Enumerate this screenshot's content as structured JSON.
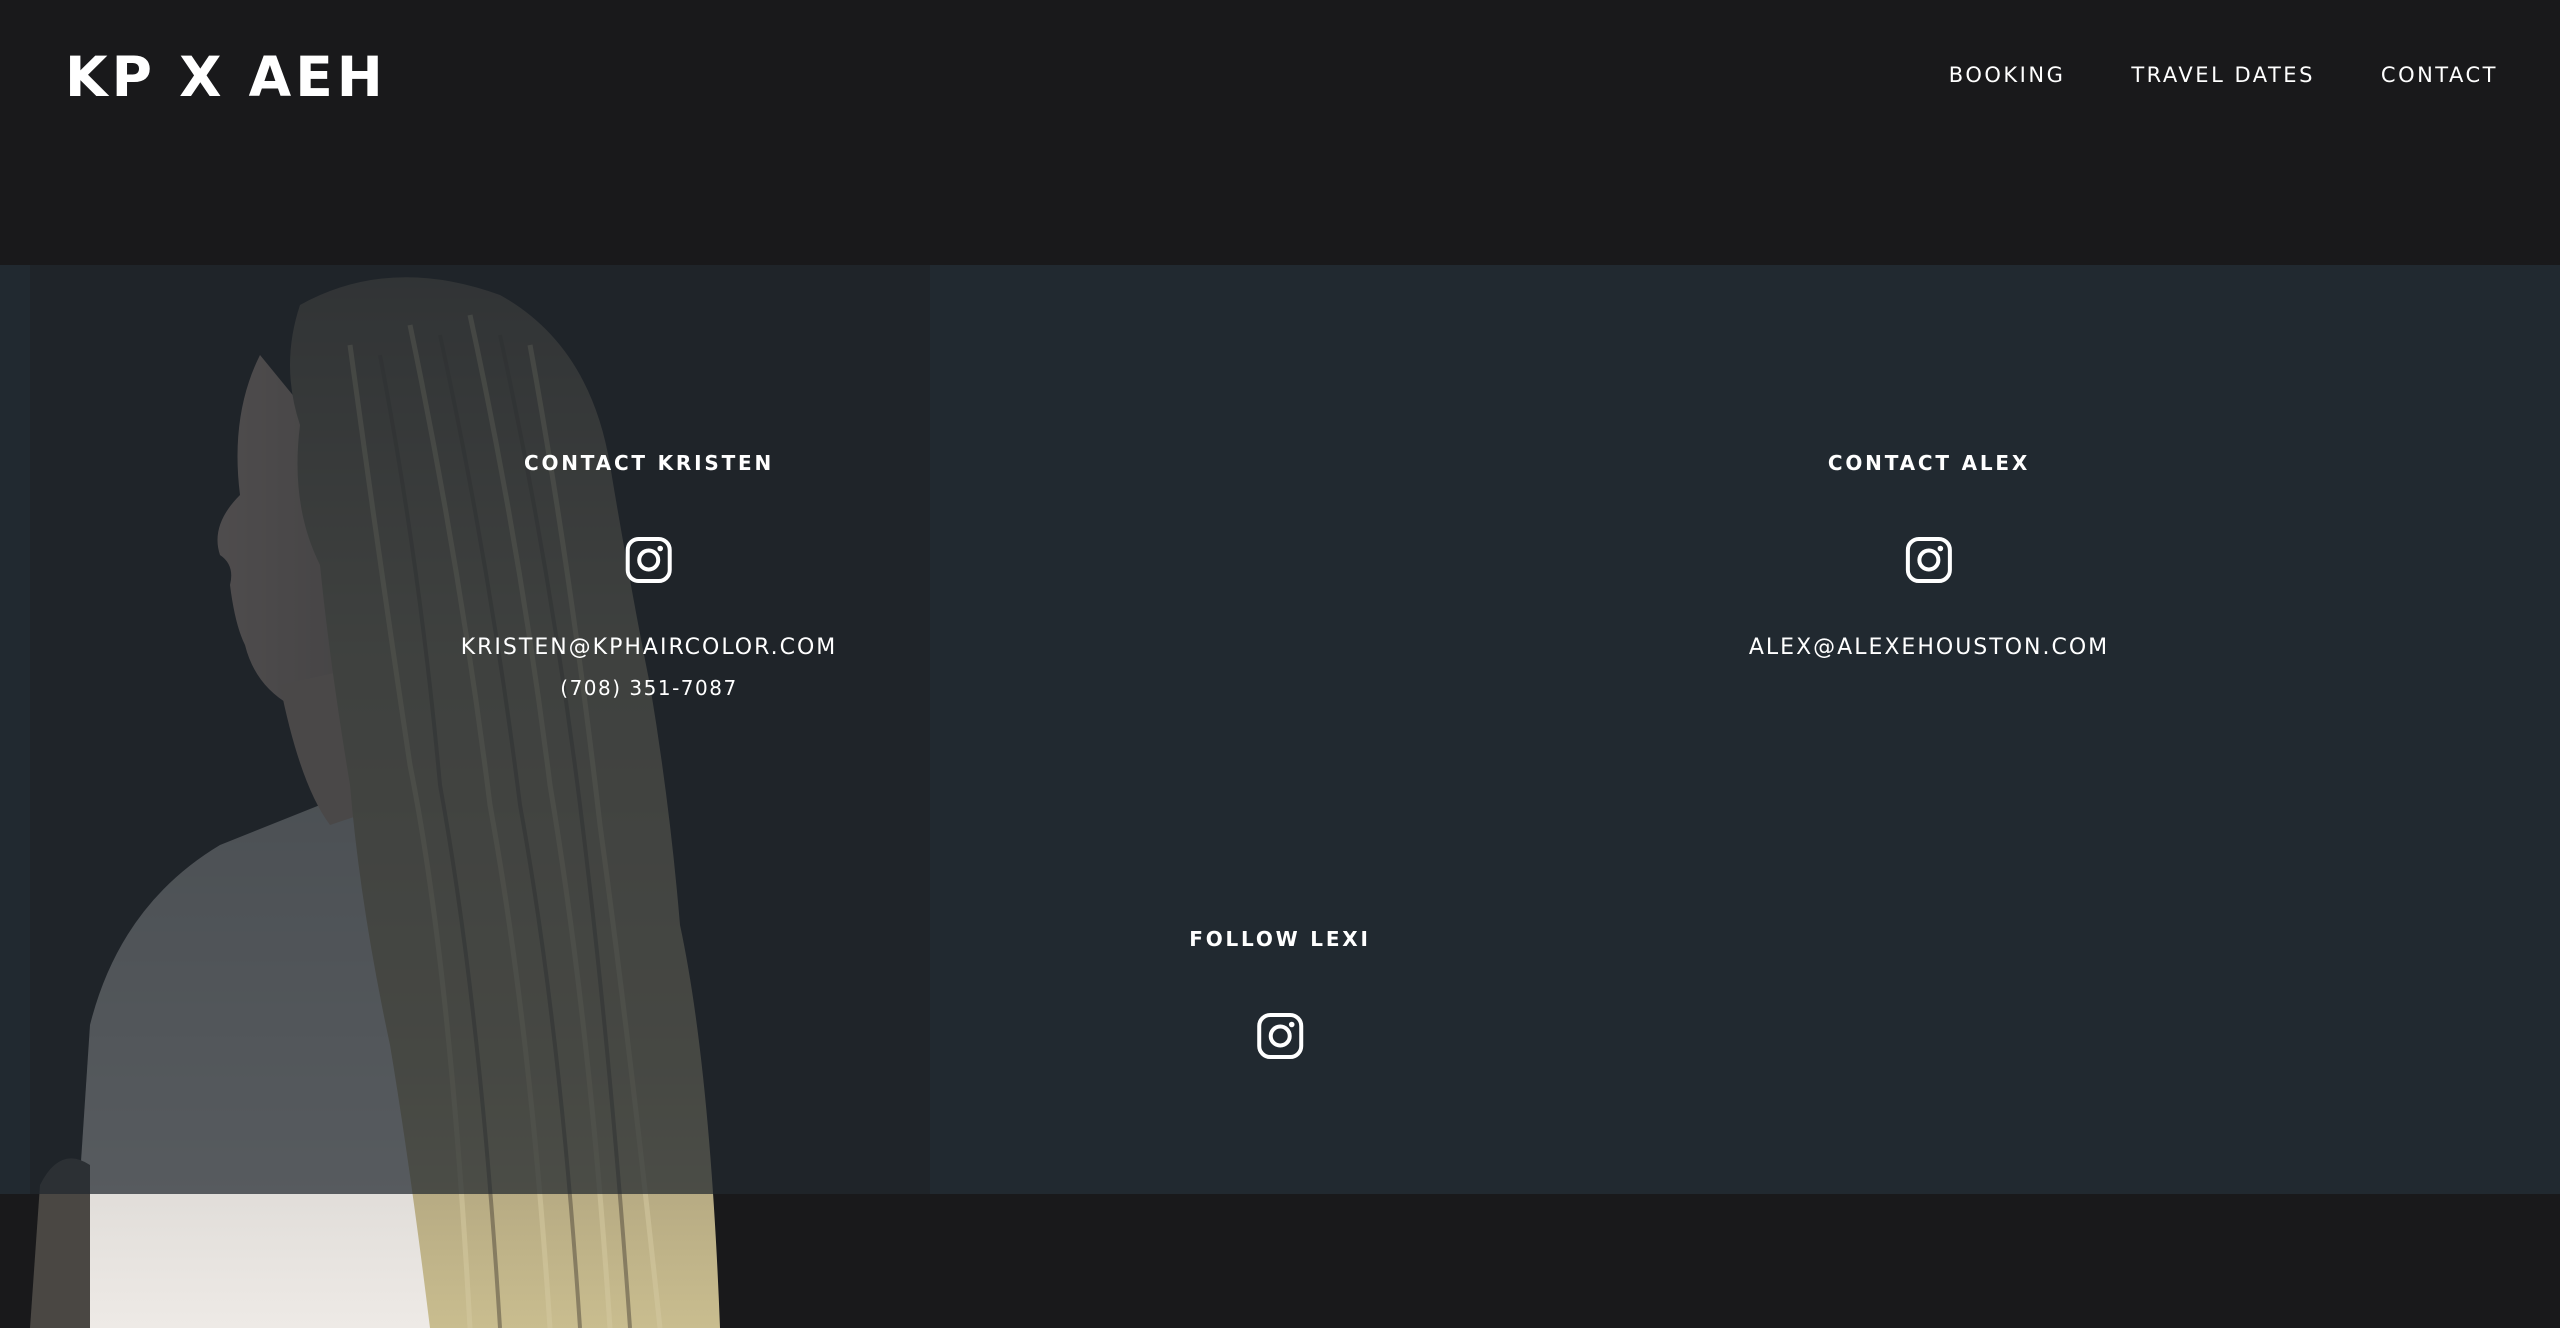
{
  "header": {
    "logo": "KP X AEH",
    "nav": [
      {
        "label": "BOOKING"
      },
      {
        "label": "TRAVEL DATES"
      },
      {
        "label": "CONTACT"
      }
    ]
  },
  "contact": {
    "kristen": {
      "title": "CONTACT KRISTEN",
      "icon": "instagram-icon",
      "email": "KRISTEN@KPHAIRCOLOR.COM",
      "phone": "(708) 351-7087"
    },
    "alex": {
      "title": "CONTACT ALEX",
      "icon": "instagram-icon",
      "email": "ALEX@ALEXEHOUSTON.COM"
    },
    "lexi": {
      "title": "FOLLOW LEXI",
      "icon": "instagram-icon"
    }
  },
  "colors": {
    "header_bg": "#19191b",
    "panel_bg": "#212930",
    "text": "#ffffff"
  }
}
